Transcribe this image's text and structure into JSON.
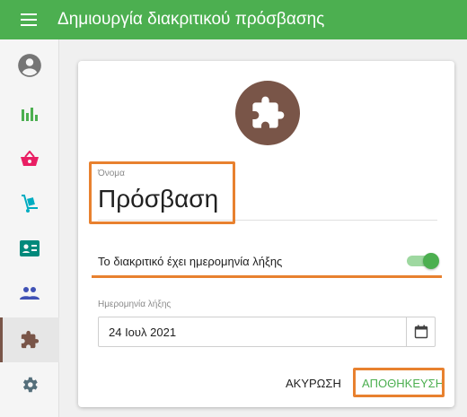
{
  "appbar": {
    "title": "Δημιουργία διακριτικού πρόσβασης",
    "menu_icon": "hamburger-menu-icon"
  },
  "sidebar": {
    "items": [
      {
        "icon": "account-circle-icon",
        "color": "#757575"
      },
      {
        "icon": "bar-chart-icon",
        "color": "#4caf50"
      },
      {
        "icon": "shopping-basket-icon",
        "color": "#e91e63"
      },
      {
        "icon": "dolly-cart-icon",
        "color": "#00acc1"
      },
      {
        "icon": "contact-card-icon",
        "color": "#00897b"
      },
      {
        "icon": "people-icon",
        "color": "#3f51b5"
      },
      {
        "icon": "puzzle-icon",
        "color": "#795548",
        "active": true
      },
      {
        "icon": "gear-icon",
        "color": "#546e7a"
      }
    ]
  },
  "form": {
    "avatar_icon": "puzzle-icon",
    "avatar_color": "#795548",
    "name_label": "Όνομα",
    "name_value": "Πρόσβαση",
    "expiry_toggle_label": "Το διακριτικό έχει ημερομηνία λήξης",
    "expiry_toggle_on": true,
    "expiry_date_label": "Ημερομηνία λήξης",
    "expiry_date_value": "24 Ιουλ 2021",
    "cancel_label": "ΑΚΥΡΩΣΗ",
    "save_label": "ΑΠΟΘΗΚΕΥΣΗ"
  },
  "colors": {
    "primary": "#4caf50",
    "highlight": "#e8812f"
  }
}
